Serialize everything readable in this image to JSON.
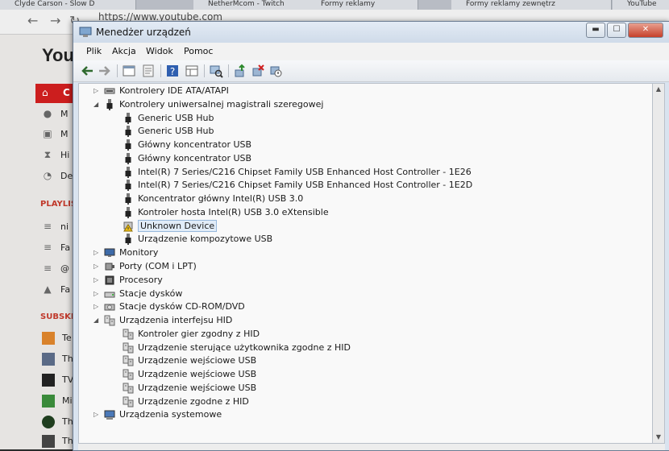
{
  "browser": {
    "tabs": [
      "Clyde Carson - Slow D",
      "NetherMcom - Twitch",
      "Formy reklamy",
      "Formy reklamy zewnętrz",
      "YouTube"
    ],
    "url": "https://www.youtube.com",
    "logo": "You",
    "side_items": [
      "C",
      "M",
      "M",
      "Hi",
      "De"
    ],
    "playlists_header": "PLAYLIS",
    "playlist_items": [
      "ni",
      "Fa",
      "@",
      "Fa"
    ],
    "subs_header": "SUBSKR",
    "sub_items": [
      "Te",
      "Th",
      "TV",
      "Mi",
      "Th",
      "Th"
    ]
  },
  "window": {
    "title": "Menedżer urządzeń",
    "controls": {
      "minimize": "▬",
      "maximize": "☐",
      "close": "✕"
    }
  },
  "menu": [
    "Plik",
    "Akcja",
    "Widok",
    "Pomoc"
  ],
  "toolbar": {
    "buttons": [
      "back-icon",
      "forward-icon",
      "show-hide-icon",
      "properties-icon",
      "help-icon",
      "view-icon",
      "scan-hardware-icon",
      "update-driver-icon",
      "uninstall-icon",
      "disable-icon"
    ]
  },
  "tree": [
    {
      "label": "Kontrolery IDE ATA/ATAPI",
      "level": 0,
      "expander": "▷",
      "icon": "ide-controller-icon"
    },
    {
      "label": "Kontrolery uniwersalnej magistrali szeregowej",
      "level": 0,
      "expander": "◢",
      "icon": "usb-icon"
    },
    {
      "label": "Generic USB Hub",
      "level": 1,
      "icon": "usb-icon"
    },
    {
      "label": "Generic USB Hub",
      "level": 1,
      "icon": "usb-icon"
    },
    {
      "label": "Główny koncentrator USB",
      "level": 1,
      "icon": "usb-icon"
    },
    {
      "label": "Główny koncentrator USB",
      "level": 1,
      "icon": "usb-icon"
    },
    {
      "label": "Intel(R) 7 Series/C216 Chipset Family USB Enhanced Host Controller - 1E26",
      "level": 1,
      "icon": "usb-icon"
    },
    {
      "label": "Intel(R) 7 Series/C216 Chipset Family USB Enhanced Host Controller - 1E2D",
      "level": 1,
      "icon": "usb-icon"
    },
    {
      "label": "Koncentrator główny Intel(R) USB 3.0",
      "level": 1,
      "icon": "usb-icon"
    },
    {
      "label": "Kontroler hosta Intel(R) USB 3.0 eXtensible",
      "level": 1,
      "icon": "usb-icon"
    },
    {
      "label": "Unknown Device",
      "level": 1,
      "icon": "warning-device-icon",
      "selected": true
    },
    {
      "label": "Urządzenie kompozytowe USB",
      "level": 1,
      "icon": "usb-icon"
    },
    {
      "label": "Monitory",
      "level": 0,
      "expander": "▷",
      "icon": "monitor-icon"
    },
    {
      "label": "Porty (COM i LPT)",
      "level": 0,
      "expander": "▷",
      "icon": "port-icon"
    },
    {
      "label": "Procesory",
      "level": 0,
      "expander": "▷",
      "icon": "processor-icon"
    },
    {
      "label": "Stacje dysków",
      "level": 0,
      "expander": "▷",
      "icon": "disk-drive-icon"
    },
    {
      "label": "Stacje dysków CD-ROM/DVD",
      "level": 0,
      "expander": "▷",
      "icon": "dvd-drive-icon"
    },
    {
      "label": "Urządzenia interfejsu HID",
      "level": 0,
      "expander": "◢",
      "icon": "hid-icon"
    },
    {
      "label": "Kontroler gier zgodny z HID",
      "level": 1,
      "icon": "hid-icon"
    },
    {
      "label": "Urządzenie sterujące użytkownika zgodne z HID",
      "level": 1,
      "icon": "hid-icon"
    },
    {
      "label": "Urządzenie wejściowe USB",
      "level": 1,
      "icon": "hid-icon"
    },
    {
      "label": "Urządzenie wejściowe USB",
      "level": 1,
      "icon": "hid-icon"
    },
    {
      "label": "Urządzenie wejściowe USB",
      "level": 1,
      "icon": "hid-icon"
    },
    {
      "label": "Urządzenie zgodne z HID",
      "level": 1,
      "icon": "hid-icon"
    },
    {
      "label": "Urządzenia systemowe",
      "level": 0,
      "expander": "▷",
      "icon": "system-devices-icon"
    }
  ],
  "colors": {
    "selection": "#e1ecf8",
    "yt_red": "#cc1e1e",
    "title_bg": "#d9e3ef"
  }
}
